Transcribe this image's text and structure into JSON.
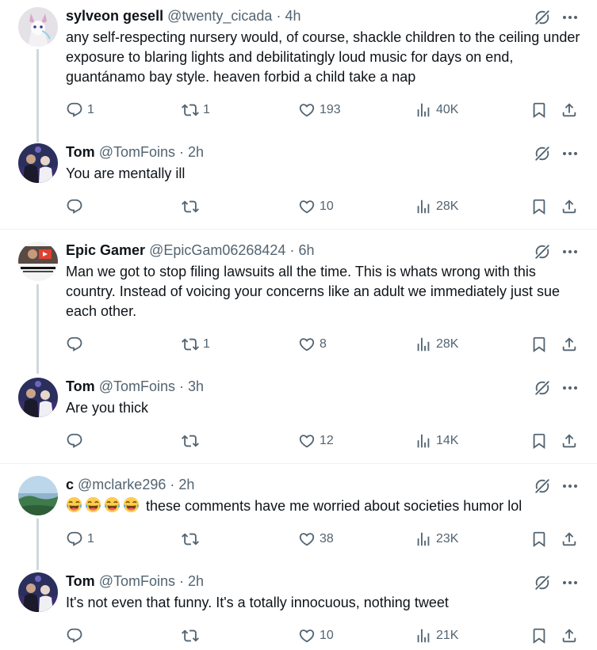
{
  "colors": {
    "text": "#0f1419",
    "muted": "#536471",
    "divider": "#eff3f4",
    "thread": "#cfd9de"
  },
  "posts": [
    {
      "name": "sylveon gesell",
      "handle": "@twenty_cicada",
      "dot": "·",
      "time": "4h",
      "text": "any self-respecting nursery would, of course, shackle children to the ceiling under exposure to blaring lights and debilitatingly loud music for days on end, guantánamo bay style. heaven forbid a child take a nap",
      "replies": "1",
      "reposts": "1",
      "likes": "193",
      "views": "40K"
    },
    {
      "name": "Tom",
      "handle": "@TomFoins",
      "dot": "·",
      "time": "2h",
      "text": "You are mentally ill",
      "replies": "",
      "reposts": "",
      "likes": "10",
      "views": "28K"
    },
    {
      "name": "Epic Gamer",
      "handle": "@EpicGam06268424",
      "dot": "·",
      "time": "6h",
      "text": "Man we got to stop filing lawsuits all the time. This is whats wrong with this country. Instead of voicing your concerns like an adult we immediately just sue each other.",
      "replies": "",
      "reposts": "1",
      "likes": "8",
      "views": "28K"
    },
    {
      "name": "Tom",
      "handle": "@TomFoins",
      "dot": "·",
      "time": "3h",
      "text": "Are you thick",
      "replies": "",
      "reposts": "",
      "likes": "12",
      "views": "14K"
    },
    {
      "name": "c",
      "handle": "@mclarke296",
      "dot": "·",
      "time": "2h",
      "text": "these comments have me worried about societies humor lol",
      "replies": "1",
      "reposts": "",
      "likes": "38",
      "views": "23K"
    },
    {
      "name": "Tom",
      "handle": "@TomFoins",
      "dot": "·",
      "time": "2h",
      "text": "It's not even that funny. It's a totally innocuous, nothing tweet",
      "replies": "",
      "reposts": "",
      "likes": "10",
      "views": "21K"
    }
  ]
}
